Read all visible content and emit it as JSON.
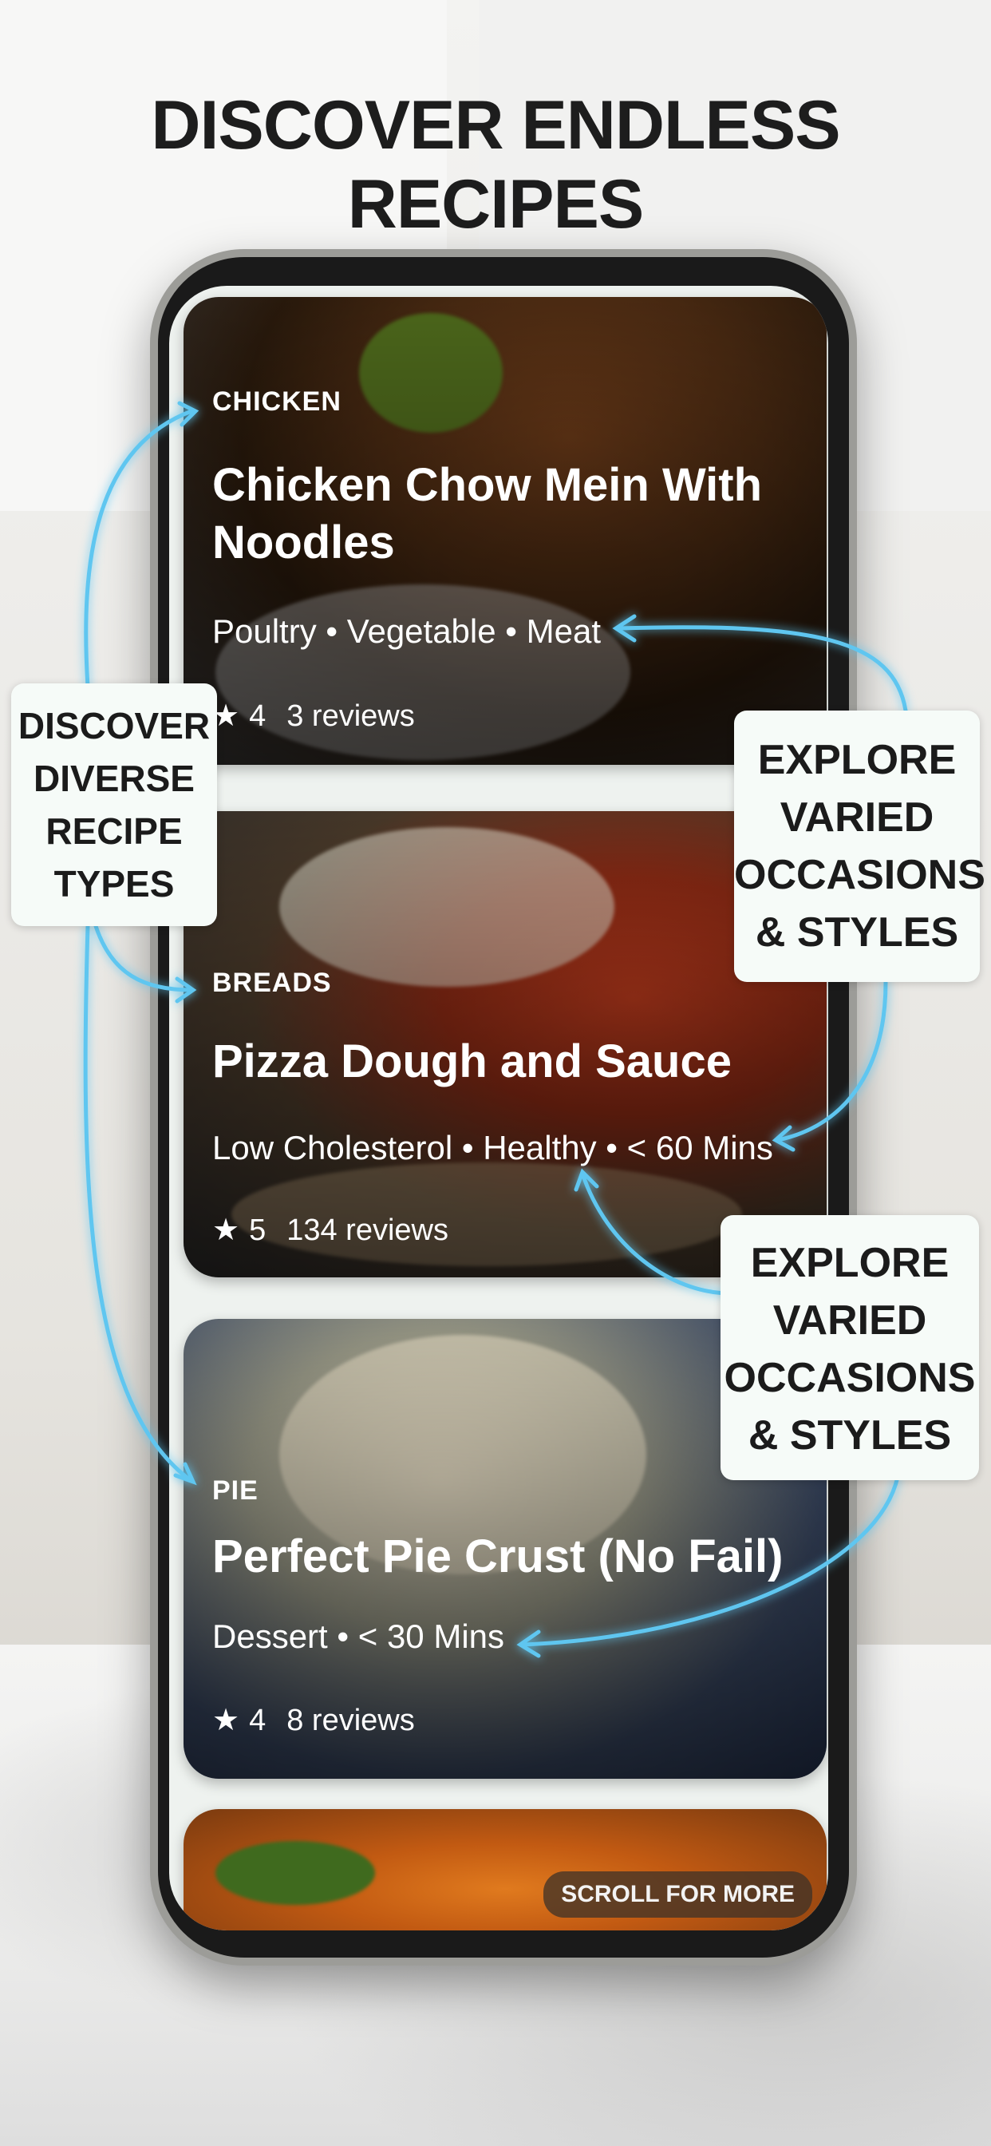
{
  "headline": "DISCOVER ENDLESS RECIPES",
  "cards": [
    {
      "category": "CHICKEN",
      "title": "Chicken Chow Mein With Noodles",
      "tags": "Poultry • Vegetable • Meat",
      "rating": "4",
      "reviews": "3 reviews"
    },
    {
      "category": "BREADS",
      "title": "Pizza Dough and Sauce",
      "tags": "Low Cholesterol • Healthy • < 60 Mins",
      "rating": "5",
      "reviews": "134 reviews"
    },
    {
      "category": "PIE",
      "title": "Perfect Pie Crust (No Fail)",
      "tags": "Dessert • < 30 Mins",
      "rating": "4",
      "reviews": "8 reviews"
    }
  ],
  "scroll_hint": "SCROLL FOR MORE",
  "callouts": {
    "left": [
      "DISCOVER",
      "DIVERSE",
      "RECIPE",
      "TYPES"
    ],
    "right_top": [
      "EXPLORE",
      "VARIED",
      "OCCASIONS",
      "& STYLES"
    ],
    "right_bottom": [
      "EXPLORE",
      "VARIED",
      "OCCASIONS",
      "& STYLES"
    ]
  },
  "icons": {
    "star": "star-icon"
  },
  "colors": {
    "arrow": "#5fc6f0",
    "headline": "#1d1d1d"
  }
}
